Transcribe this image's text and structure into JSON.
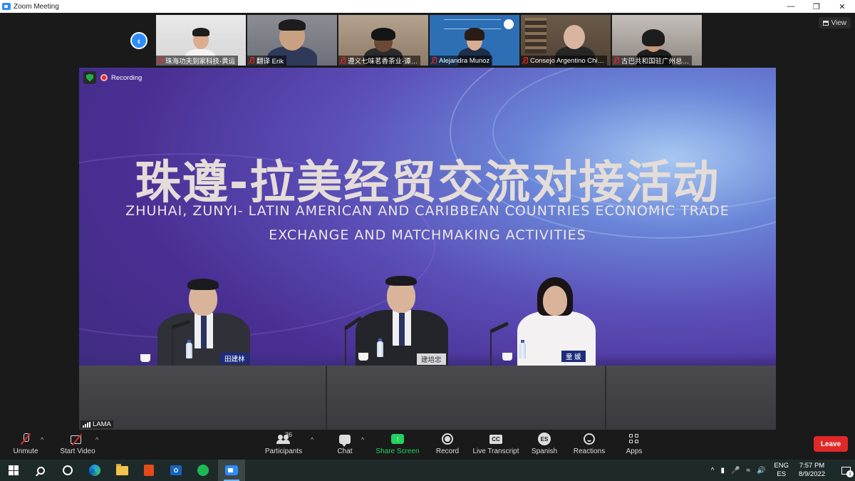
{
  "window": {
    "title": "Zoom Meeting",
    "minimize_icon": "minimize-icon",
    "restore_icon": "restore-icon",
    "close_icon": "close-icon"
  },
  "top_right": {
    "view_label": "View"
  },
  "participants_strip": [
    {
      "name": "珠海功夫到家科技-黄运",
      "muted": true
    },
    {
      "name": "翻译 Erik",
      "muted": true
    },
    {
      "name": "遵义七味茗香茶业-谭…",
      "muted": true
    },
    {
      "name": "Alejandra Munoz",
      "muted": true
    },
    {
      "name": "Consejo Argentino Chi…",
      "muted": true
    },
    {
      "name": "古巴共和国驻广州总…",
      "muted": true
    }
  ],
  "main_video": {
    "recording_label": "Recording",
    "banner_cn": "珠遵-拉美经贸交流对接活动",
    "banner_en_line1": "ZHUHAI, ZUNYI- LATIN AMERICAN AND CARIBBEAN COUNTRIES ECONOMIC TRADE",
    "banner_en_line2": "EXCHANGE AND MATCHMAKING ACTIVITIES",
    "nameplates": [
      "田建林",
      "建培忠",
      "童 媛"
    ],
    "participant_label": "LAMA"
  },
  "toolbar": {
    "unmute": "Unmute",
    "start_video": "Start Video",
    "participants": "Participants",
    "participants_count": "36",
    "chat": "Chat",
    "share_screen": "Share Screen",
    "record": "Record",
    "live_transcript": "Live Transcript",
    "cc_label": "CC",
    "language": "Spanish",
    "language_code": "ES",
    "reactions": "Reactions",
    "apps": "Apps",
    "leave": "Leave"
  },
  "taskbar": {
    "outlook_letter": "O",
    "lang_top": "ENG",
    "lang_bottom": "ES",
    "time": "7:57 PM",
    "date": "8/9/2022",
    "notification_count": "1",
    "tray_caret": "^"
  },
  "colors": {
    "accent": "#2d8cff",
    "leave": "#e02828",
    "share": "#23d160",
    "banner_purple": "#4a2f93"
  }
}
